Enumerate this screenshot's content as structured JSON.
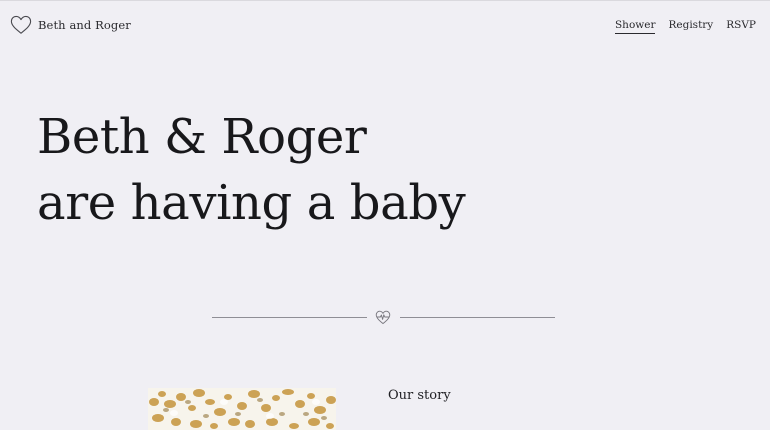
{
  "header": {
    "brand": {
      "name": "Beth and Roger",
      "icon": "heart-outline-icon"
    },
    "nav": [
      {
        "label": "Shower",
        "active": true
      },
      {
        "label": "Registry",
        "active": false
      },
      {
        "label": "RSVP",
        "active": false
      }
    ]
  },
  "hero": {
    "line1": "Beth & Roger",
    "line2": "are having a baby"
  },
  "divider": {
    "icon": "heartbeat-heart-icon"
  },
  "story": {
    "heading": "Our story",
    "image": "autumn-foliage-photo"
  },
  "colors": {
    "background": "#f0eff4",
    "text": "#1f1f23",
    "rule": "#8f8e95",
    "foliage": "#c89a45"
  }
}
